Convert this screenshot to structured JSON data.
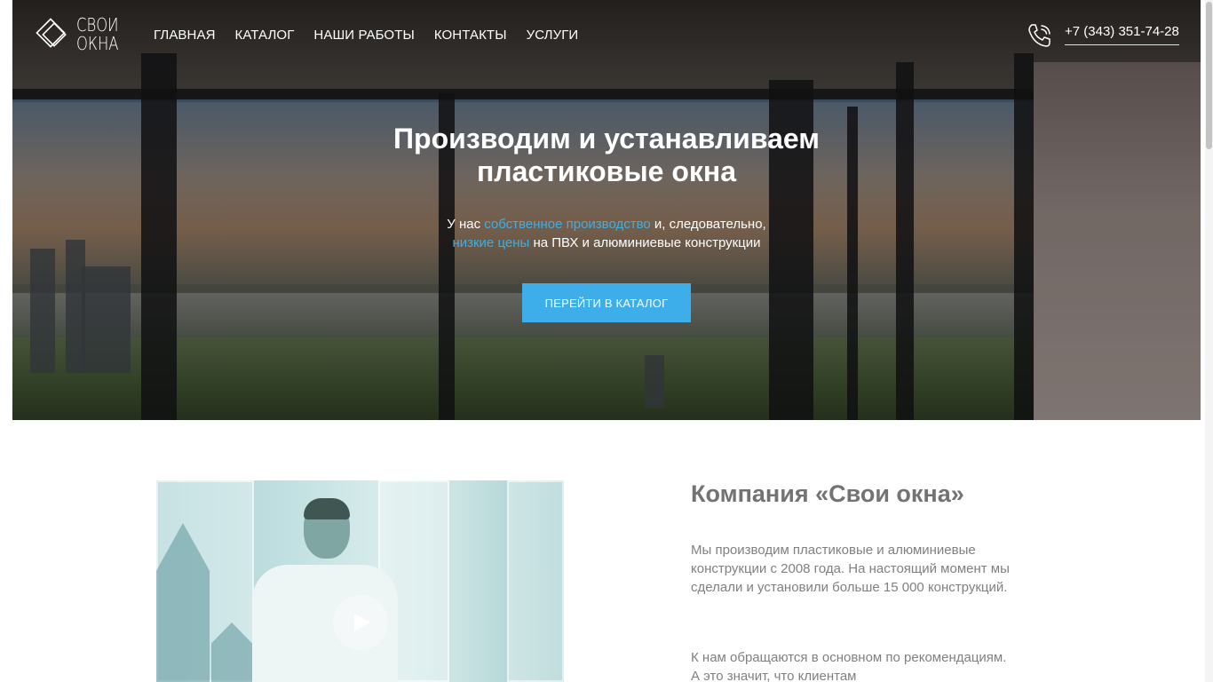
{
  "brand": {
    "logo_line1": "СВОИ",
    "logo_line2": "ОКНА"
  },
  "nav": {
    "items": [
      {
        "label": "ГЛАВНАЯ"
      },
      {
        "label": "КАТАЛОГ"
      },
      {
        "label": "НАШИ РАБОТЫ"
      },
      {
        "label": "КОНТАКТЫ"
      },
      {
        "label": "УСЛУГИ"
      }
    ]
  },
  "contact": {
    "phone": "+7 (343) 351-74-28",
    "phone_icon": "phone-icon"
  },
  "hero": {
    "title_line1": "Производим и устанавливаем",
    "title_line2": "пластиковые окна",
    "sub_prefix": "У нас ",
    "sub_link1": "собственное производство",
    "sub_mid": " и, следовательно,",
    "sub_link2": "низкие цены",
    "sub_suffix": " на ПВХ и алюминиевые конструкции",
    "cta_label": "ПЕРЕЙТИ В КАТАЛОГ"
  },
  "about": {
    "title": "Компания «Свои окна»",
    "paragraph1": "Мы производим пластиковые и алюминиевые конструкции с 2008 года. На настоящий момент мы сделали и установили больше 15 000 конструкций.",
    "paragraph2": "К нам обращаются в основном по рекомендациям. А это значит, что клиентам",
    "video_play_icon": "play-icon"
  },
  "colors": {
    "accent": "#3daee9",
    "heading_gray": "#737373",
    "text_gray": "#808080"
  }
}
